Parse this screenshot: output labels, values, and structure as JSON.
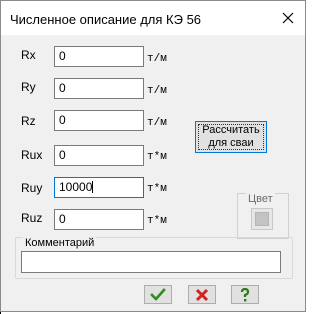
{
  "window": {
    "title": "Численное описание для КЭ 56"
  },
  "fields": [
    {
      "label": "Rx",
      "value": "0",
      "unit": "т/м"
    },
    {
      "label": "Ry",
      "value": "0",
      "unit": "т/м"
    },
    {
      "label": "Rz",
      "value": "0",
      "unit": "т/м"
    },
    {
      "label": "Rux",
      "value": "0",
      "unit": "т*м"
    },
    {
      "label": "Ruy",
      "value": "10000",
      "unit": "т*м"
    },
    {
      "label": "Ruz",
      "value": "0",
      "unit": "т*м"
    }
  ],
  "calc_button": {
    "line1": "Рассчитать",
    "line2": "для сваи"
  },
  "color": {
    "label": "Цвет",
    "swatch": "#c3c3c3"
  },
  "comment": {
    "label": "Комментарий",
    "value": ""
  },
  "actions": {
    "ok_icon": "checkmark-icon",
    "cancel_icon": "x-icon",
    "help_icon": "question-icon",
    "ok_color": "#2e8b1e",
    "cancel_color": "#d42020",
    "help_color": "#2e7a1e"
  }
}
